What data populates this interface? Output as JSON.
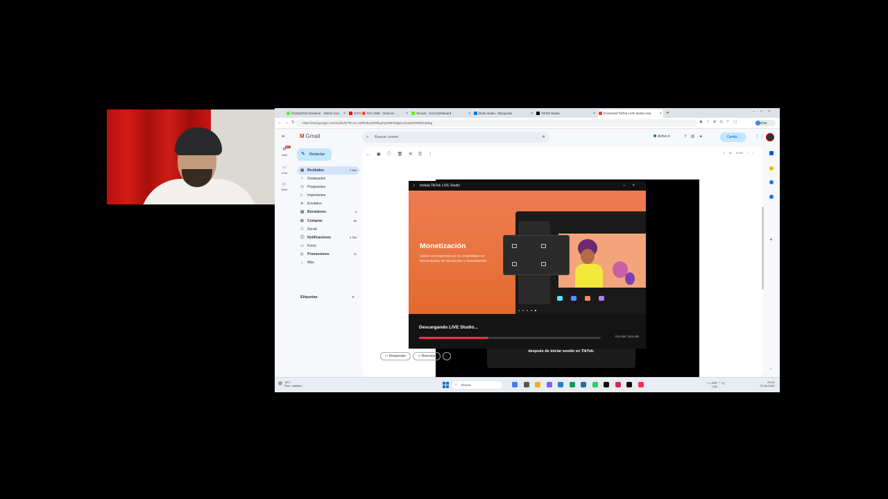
{
  "browser": {
    "tabs": [
      {
        "label": "Charly2018 Streamer - Watch Live",
        "color": "#53fc18"
      },
      {
        "label": "(137) 🔴 IVIV SMK - Reaccio",
        "color": "#ff0000"
      },
      {
        "label": "Stream - Kick Dashboard",
        "color": "#53fc18"
      },
      {
        "label": "tiktok studio - Búsqueda",
        "color": "#0078d4"
      },
      {
        "label": "TikTok Studio",
        "color": "#000000"
      },
      {
        "label": "Download TikTok LIVE Studio now",
        "color": "#ea4335"
      }
    ],
    "url": "https://mail.google.com/mail/u/0/?hl=es-419#inbox/FMfcgzQnWBVDpjDCxhxdZvRRMhzdNbqj",
    "profile_label": "Char"
  },
  "gmail": {
    "logo_text": "Gmail",
    "search_placeholder": "Buscar correo",
    "status": "Activo",
    "cambio_label": "Cambi...",
    "compose_label": "Redactar",
    "rail": [
      {
        "label": "Mail",
        "badge": "99+",
        "icon": "mail-icon"
      },
      {
        "label": "Chat",
        "icon": "chat-icon"
      },
      {
        "label": "Meet",
        "icon": "video-icon"
      }
    ],
    "folders": [
      {
        "label": "Recibidos",
        "count": "7.160",
        "icon": "inbox-icon",
        "glyph": "▣",
        "state": "sel"
      },
      {
        "label": "Destacados",
        "count": "",
        "icon": "star-icon",
        "glyph": "☆",
        "state": ""
      },
      {
        "label": "Pospuestos",
        "count": "",
        "icon": "clock-icon",
        "glyph": "◷",
        "state": ""
      },
      {
        "label": "Importantes",
        "count": "",
        "icon": "important-icon",
        "glyph": "▷",
        "state": ""
      },
      {
        "label": "Enviados",
        "count": "",
        "icon": "send-icon",
        "glyph": "➤",
        "state": ""
      },
      {
        "label": "Borradores",
        "count": "9",
        "icon": "draft-icon",
        "glyph": "▤",
        "state": "bold"
      },
      {
        "label": "Compras",
        "count": "92",
        "icon": "cart-icon",
        "glyph": "⊞",
        "state": "bold"
      },
      {
        "label": "Social",
        "count": "",
        "icon": "people-icon",
        "glyph": "⚇",
        "state": ""
      },
      {
        "label": "Notificaciones",
        "count": "6.784",
        "icon": "info-icon",
        "glyph": "ⓘ",
        "state": "bold"
      },
      {
        "label": "Foros",
        "count": "",
        "icon": "forum-icon",
        "glyph": "▭",
        "state": ""
      },
      {
        "label": "Promociones",
        "count": "71",
        "icon": "tag-icon",
        "glyph": "◇",
        "state": "bold"
      },
      {
        "label": "Más",
        "count": "",
        "icon": "chevron-down-icon",
        "glyph": "⌄",
        "state": ""
      }
    ],
    "labels_heading": "Etiquetas",
    "pager": "1 de 6.091",
    "mail_text": "después de iniciar sesión en TikTok.",
    "reply_label": "Responder",
    "forward_label": "Reenviar"
  },
  "installer": {
    "window_title": "Instala TikTok LIVE Studio",
    "heading": "Monetización",
    "description": "Obtén recompensas por tu creatividad con herramientas de interacción y monetización.",
    "download_label": "Descargando LIVE Studio...",
    "progress": 0.38,
    "size_text": "315 MB / 825 MB",
    "accent": "#fe2c55"
  },
  "taskbar": {
    "weather_temp": "18°C",
    "weather_desc": "Parc. nublado",
    "search_placeholder": "Buscar",
    "lang": "ESP",
    "lang_sub": "LAA",
    "time": "23:15",
    "date": "27-06-2025",
    "apps": [
      "#3b82f6",
      "#555555",
      "#f4b400",
      "#7b61ff",
      "#2b7cd3",
      "#0f9d58",
      "#1d6fa5",
      "#25d366",
      "#111111",
      "#e0245e",
      "#111111",
      "#fe2c55"
    ]
  }
}
